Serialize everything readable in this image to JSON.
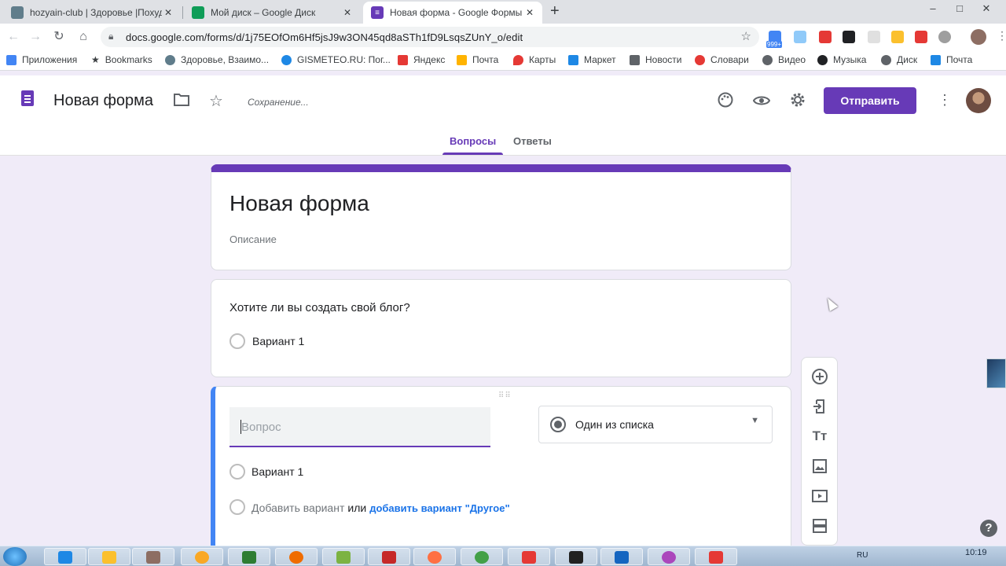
{
  "browser": {
    "tabs": [
      {
        "title": "hozyain-club | Здоровье |Похуде",
        "close": "✕",
        "active": false,
        "favicon_color": "#607d8b"
      },
      {
        "title": "Мой диск – Google Диск",
        "close": "✕",
        "active": false,
        "favicon_color": "#0f9d58"
      },
      {
        "title": "Новая форма - Google Формы",
        "close": "✕",
        "active": true,
        "favicon_color": "#673ab7"
      }
    ],
    "new_tab": "+",
    "window_controls": {
      "minimize": "–",
      "maximize": "□",
      "close": "✕"
    },
    "nav": {
      "back": "←",
      "forward": "→",
      "reload": "↻",
      "home": "⌂"
    },
    "url": "docs.google.com/forms/d/1j75EOfOm6Hf5jsJ9w3ON45qd8aSTh1fD9LsqsZUnY_o/edit",
    "extension_badge": "999+",
    "bookmarks": [
      {
        "label": "Приложения",
        "color": "#4285f4"
      },
      {
        "label": "Bookmarks",
        "color": "#5f6368"
      },
      {
        "label": "Здоровье, Взаимо...",
        "color": "#607d8b"
      },
      {
        "label": "GISMETEO.RU: Пог...",
        "color": "#1e88e5"
      },
      {
        "label": "Яндекс",
        "color": "#e53935"
      },
      {
        "label": "Почта",
        "color": "#ffb300"
      },
      {
        "label": "Карты",
        "color": "#e53935"
      },
      {
        "label": "Маркет",
        "color": "#1e88e5"
      },
      {
        "label": "Новости",
        "color": "#5f6368"
      },
      {
        "label": "Словари",
        "color": "#e53935"
      },
      {
        "label": "Видео",
        "color": "#5f6368"
      },
      {
        "label": "Музыка",
        "color": "#202124"
      },
      {
        "label": "Диск",
        "color": "#5f6368"
      },
      {
        "label": "Почта",
        "color": "#1e88e5"
      }
    ]
  },
  "forms_header": {
    "form_name": "Новая форма",
    "saving": "Сохранение...",
    "send_button": "Отправить",
    "tabs": {
      "questions": "Вопросы",
      "responses": "Ответы"
    },
    "accent_color": "#673ab7"
  },
  "title_card": {
    "title": "Новая форма",
    "description": "Описание"
  },
  "question1": {
    "text": "Хотите ли вы создать свой блог?",
    "option1": "Вариант 1"
  },
  "question2": {
    "placeholder": "Вопрос",
    "type": "Один из списка",
    "option1": "Вариант 1",
    "add_option": "Добавить вариант",
    "or": "или",
    "add_other": "добавить вариант \"Другое\""
  },
  "sidebar_icons": [
    "add-question-icon",
    "import-questions-icon",
    "add-title-icon",
    "add-image-icon",
    "add-video-icon",
    "add-section-icon"
  ],
  "help": "?",
  "taskbar": {
    "lang": "RU",
    "time": "10:19"
  }
}
